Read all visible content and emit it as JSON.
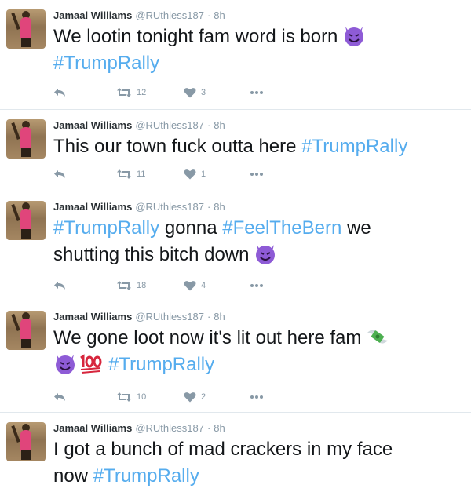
{
  "tweets": [
    {
      "name": "Jamaal Williams",
      "handle": "@RUthless187",
      "dot": "·",
      "time": "8h",
      "retweets": "12",
      "likes": "3",
      "parts": [
        "We lootin tonight fam word is born",
        "#TrumpRally"
      ]
    },
    {
      "name": "Jamaal Williams",
      "handle": "@RUthless187",
      "dot": "·",
      "time": "8h",
      "retweets": "11",
      "likes": "1",
      "parts": [
        "This our town fuck outta here",
        "#TrumpRally"
      ]
    },
    {
      "name": "Jamaal Williams",
      "handle": "@RUthless187",
      "dot": "·",
      "time": "8h",
      "retweets": "18",
      "likes": "4",
      "parts": [
        "#TrumpRally",
        "gonna",
        "#FeelTheBern",
        "we",
        "shutting this bitch down"
      ]
    },
    {
      "name": "Jamaal Williams",
      "handle": "@RUthless187",
      "dot": "·",
      "time": "8h",
      "retweets": "10",
      "likes": "2",
      "parts": [
        "We gone loot now it's lit out here fam",
        "#TrumpRally"
      ]
    },
    {
      "name": "Jamaal Williams",
      "handle": "@RUthless187",
      "dot": "·",
      "time": "8h",
      "parts": [
        "I got a bunch of mad crackers in my face",
        "now",
        "#TrumpRally"
      ]
    }
  ],
  "icons": {
    "reply": "reply-icon",
    "retweet": "retweet-icon",
    "like": "heart-icon",
    "more": "more-icon",
    "emoji_devil": "smiling-devil-emoji",
    "emoji_money": "money-with-wings-emoji",
    "emoji_100": "hundred-points-emoji"
  },
  "colors": {
    "hashtag": "#55acee",
    "icon": "#8899a6",
    "devil": "#8e5bd6",
    "hundred": "#d7263d"
  }
}
